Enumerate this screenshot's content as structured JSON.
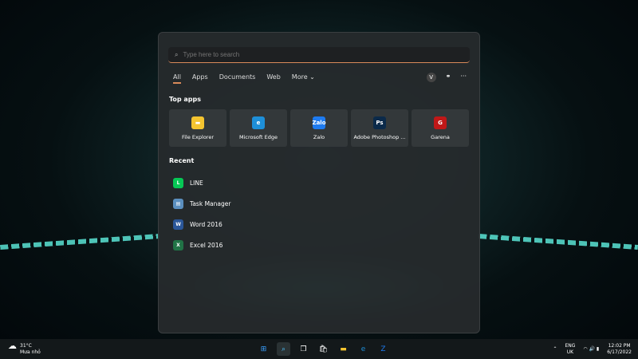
{
  "search": {
    "placeholder": "Type here to search"
  },
  "tabs": [
    "All",
    "Apps",
    "Documents",
    "Web",
    "More ⌄"
  ],
  "account_initial": "V",
  "top_apps_label": "Top apps",
  "top_apps": [
    {
      "name": "File Explorer",
      "color": "#f4c430",
      "glyph": "▬"
    },
    {
      "name": "Microsoft Edge",
      "color": "#1e8fd8",
      "glyph": "e"
    },
    {
      "name": "Zalo",
      "color": "#1e7bf0",
      "glyph": "Zalo"
    },
    {
      "name": "Adobe Photoshop ...",
      "color": "#0b2a4a",
      "glyph": "Ps"
    },
    {
      "name": "Garena",
      "color": "#c01818",
      "glyph": "G"
    }
  ],
  "recent_label": "Recent",
  "recent": [
    {
      "name": "LINE",
      "color": "#06c755",
      "glyph": "L"
    },
    {
      "name": "Task Manager",
      "color": "#5b8fbf",
      "glyph": "▤"
    },
    {
      "name": "Word 2016",
      "color": "#2b579a",
      "glyph": "W"
    },
    {
      "name": "Excel 2016",
      "color": "#217346",
      "glyph": "X"
    }
  ],
  "weather": {
    "temp": "31°C",
    "desc": "Mưa nhỏ"
  },
  "tray": {
    "lang1": "ENG",
    "lang2": "UK",
    "time": "12:02 PM",
    "date": "6/17/2022"
  }
}
